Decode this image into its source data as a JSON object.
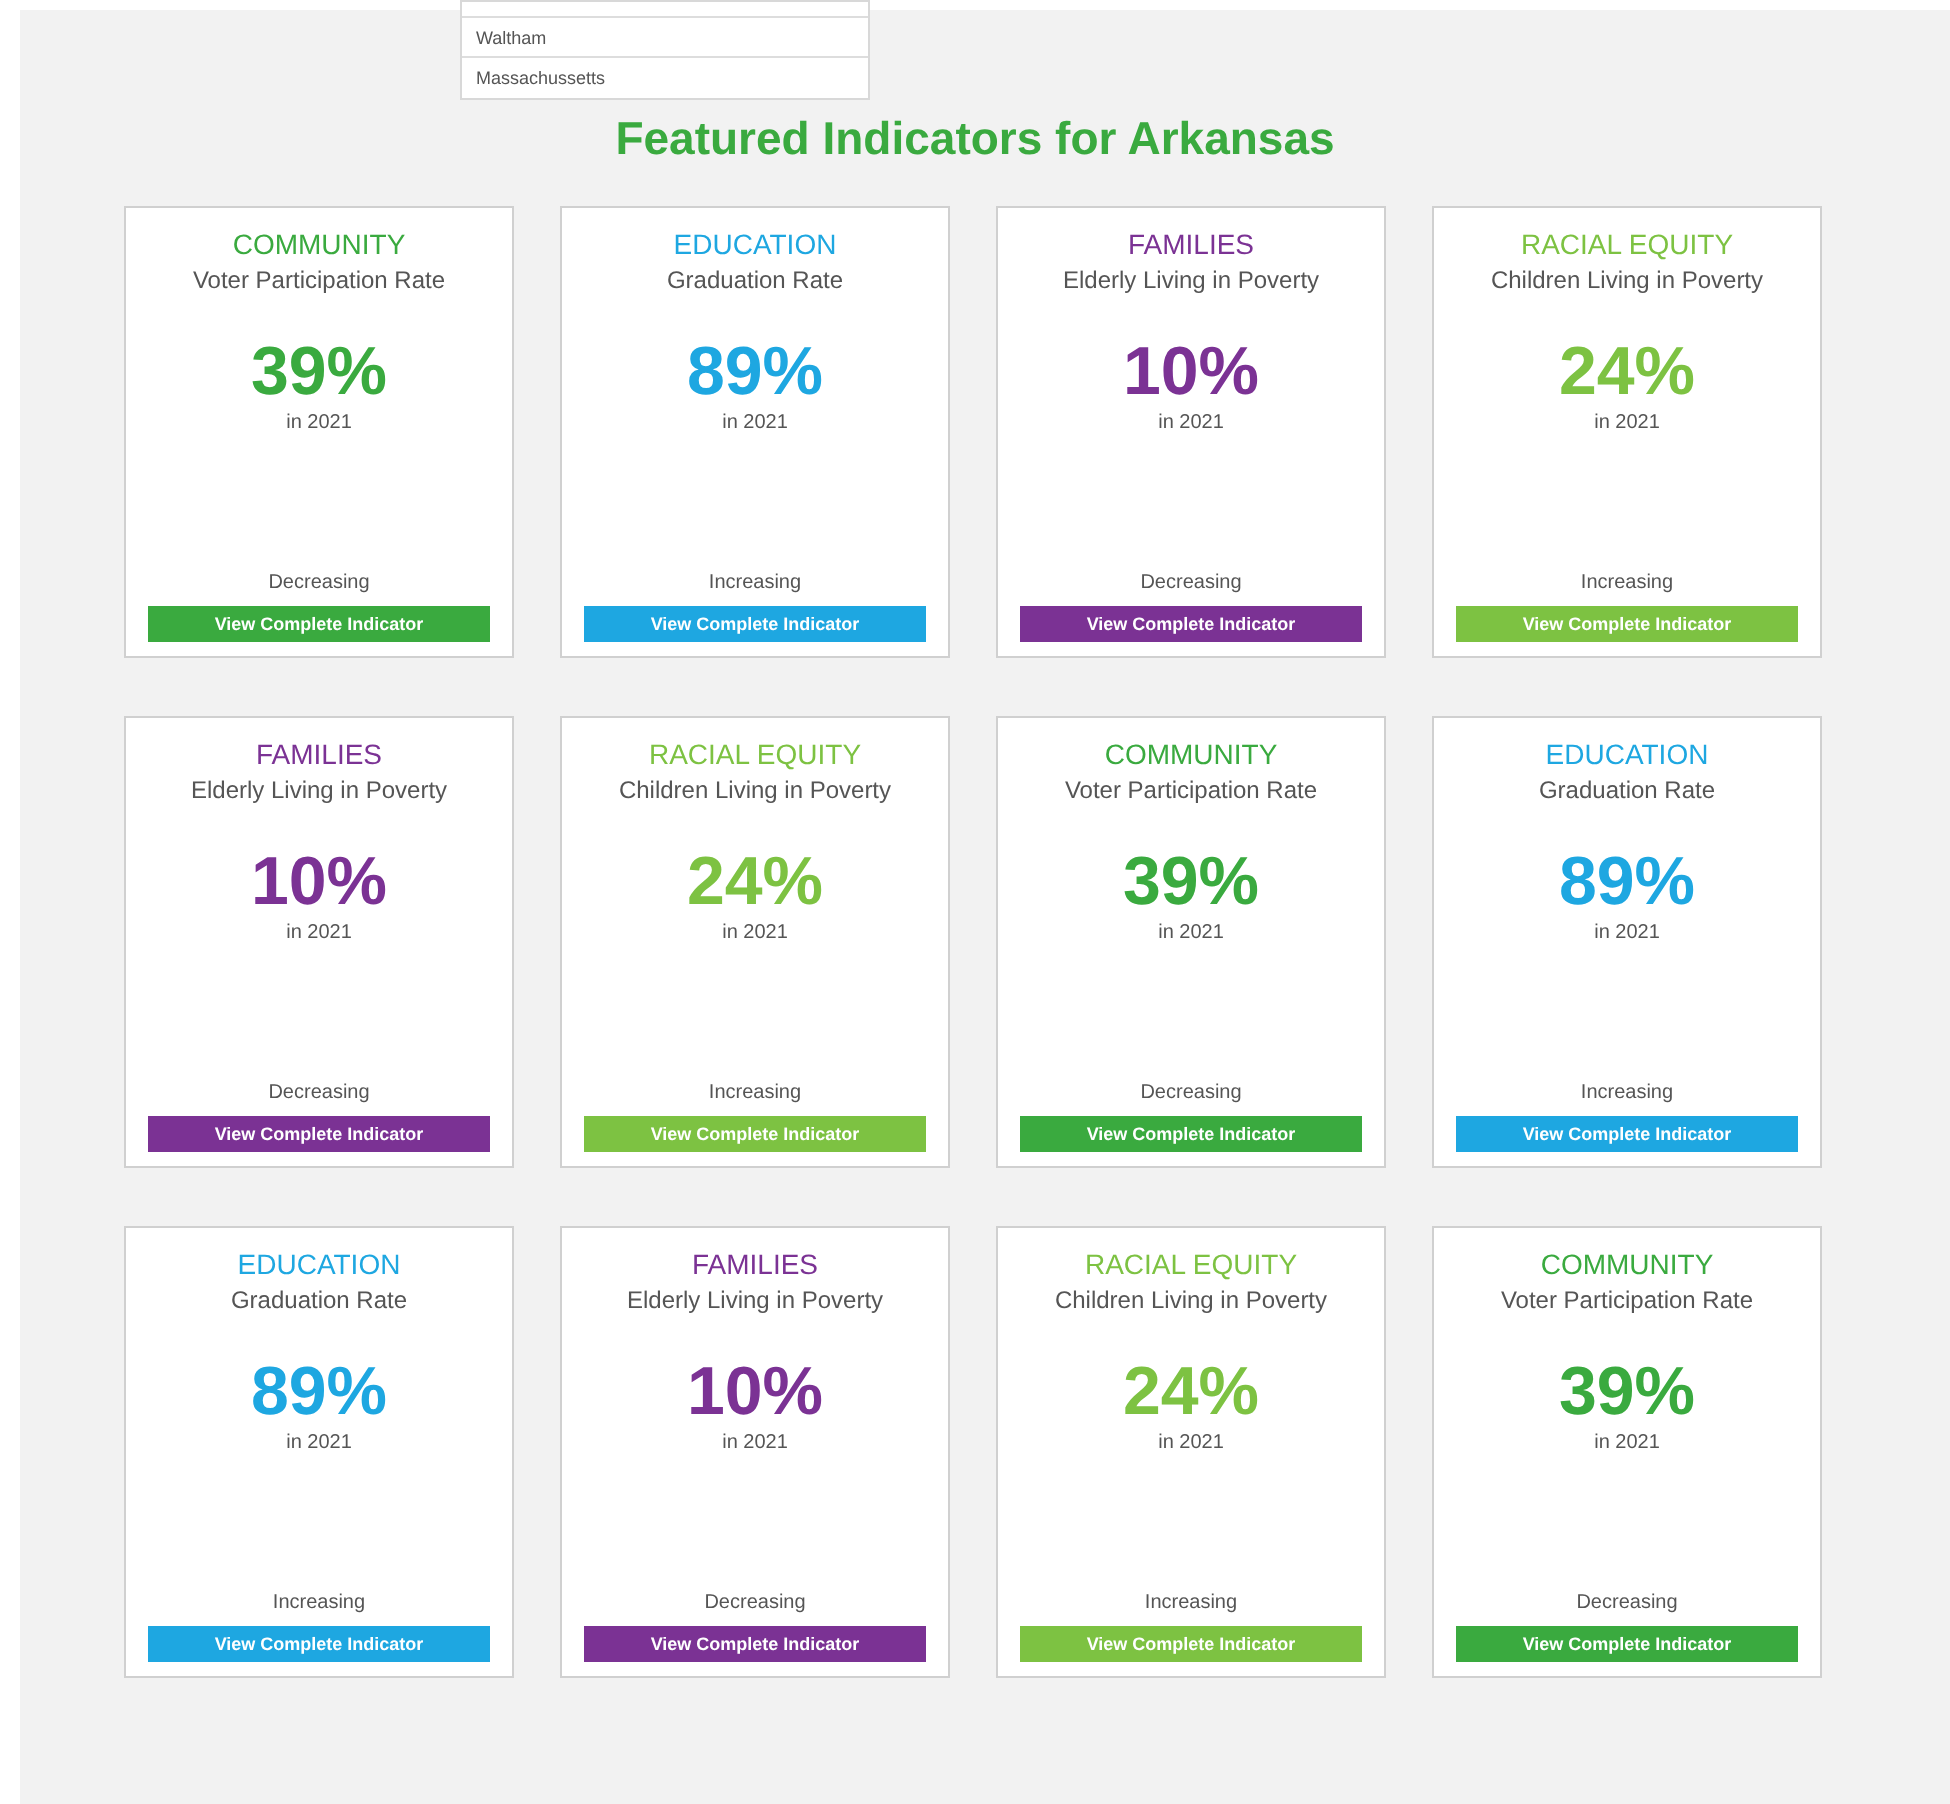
{
  "location_list": {
    "items": [
      "Waltham",
      "Massachussetts"
    ]
  },
  "heading": "Featured Indicators for Arkansas",
  "cards": [
    {
      "category": "COMMUNITY",
      "indicator": "Voter Participation Rate",
      "value": "39%",
      "year": "in 2021",
      "trend": "Decreasing",
      "button": "View Complete Indicator",
      "color": "#3aaa3f"
    },
    {
      "category": "EDUCATION",
      "indicator": "Graduation Rate",
      "value": "89%",
      "year": "in 2021",
      "trend": "Increasing",
      "button": "View Complete Indicator",
      "color": "#1ea7e1"
    },
    {
      "category": "FAMILIES",
      "indicator": "Elderly Living in Poverty",
      "value": "10%",
      "year": "in 2021",
      "trend": "Decreasing",
      "button": "View Complete Indicator",
      "color": "#7b3294"
    },
    {
      "category": "RACIAL EQUITY",
      "indicator": "Children Living in Poverty",
      "value": "24%",
      "year": "in 2021",
      "trend": "Increasing",
      "button": "View Complete Indicator",
      "color": "#7dc242"
    },
    {
      "category": "FAMILIES",
      "indicator": "Elderly Living in Poverty",
      "value": "10%",
      "year": "in 2021",
      "trend": "Decreasing",
      "button": "View Complete Indicator",
      "color": "#7b3294"
    },
    {
      "category": "RACIAL EQUITY",
      "indicator": "Children Living in Poverty",
      "value": "24%",
      "year": "in 2021",
      "trend": "Increasing",
      "button": "View Complete Indicator",
      "color": "#7dc242"
    },
    {
      "category": "COMMUNITY",
      "indicator": "Voter Participation Rate",
      "value": "39%",
      "year": "in 2021",
      "trend": "Decreasing",
      "button": "View Complete Indicator",
      "color": "#3aaa3f"
    },
    {
      "category": "EDUCATION",
      "indicator": "Graduation Rate",
      "value": "89%",
      "year": "in 2021",
      "trend": "Increasing",
      "button": "View Complete Indicator",
      "color": "#1ea7e1"
    },
    {
      "category": "EDUCATION",
      "indicator": "Graduation Rate",
      "value": "89%",
      "year": "in 2021",
      "trend": "Increasing",
      "button": "View Complete Indicator",
      "color": "#1ea7e1"
    },
    {
      "category": "FAMILIES",
      "indicator": "Elderly Living in Poverty",
      "value": "10%",
      "year": "in 2021",
      "trend": "Decreasing",
      "button": "View Complete Indicator",
      "color": "#7b3294"
    },
    {
      "category": "RACIAL EQUITY",
      "indicator": "Children Living in Poverty",
      "value": "24%",
      "year": "in 2021",
      "trend": "Increasing",
      "button": "View Complete Indicator",
      "color": "#7dc242"
    },
    {
      "category": "COMMUNITY",
      "indicator": "Voter Participation Rate",
      "value": "39%",
      "year": "in 2021",
      "trend": "Decreasing",
      "button": "View Complete Indicator",
      "color": "#3aaa3f"
    }
  ]
}
